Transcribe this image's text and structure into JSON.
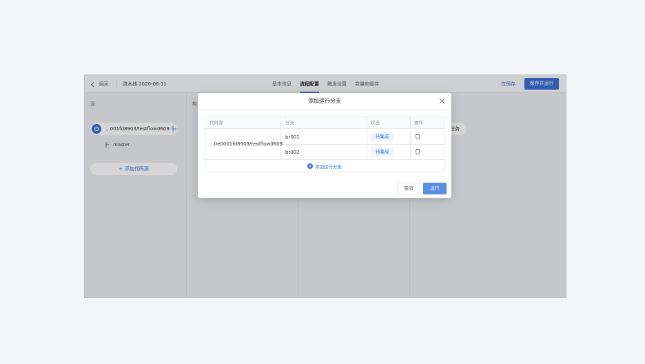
{
  "header": {
    "back_label": "返回",
    "pipeline_title": "流水线 2020-06-11",
    "tabs": [
      {
        "label": "基本信息",
        "active": false
      },
      {
        "label": "流程配置",
        "active": true
      },
      {
        "label": "触发设置",
        "active": false
      },
      {
        "label": "变量和缓存",
        "active": false
      }
    ],
    "save_only_label": "仅保存",
    "save_and_run_label": "保存并运行"
  },
  "canvas": {
    "col1_label": "源",
    "col2_label": "构",
    "repo_name": "...001fd8903/testflow0609",
    "branch_name": "master",
    "add_repo_label": "添加代码源",
    "task_chip_label": "任务"
  },
  "modal": {
    "title": "添加运行分支",
    "columns": [
      "代码源",
      "分支",
      "状态",
      "操作"
    ],
    "source": "...0e0001fd8903/testflow0609",
    "rows": [
      {
        "branch": "br001",
        "status": "待集成"
      },
      {
        "branch": "br002",
        "status": "待集成"
      }
    ],
    "add_branch_label": "添加运行分支",
    "cancel_label": "取消",
    "run_label": "运行"
  },
  "colors": {
    "primary": "#3b6fd6",
    "run_button": "#5b8ee0"
  }
}
